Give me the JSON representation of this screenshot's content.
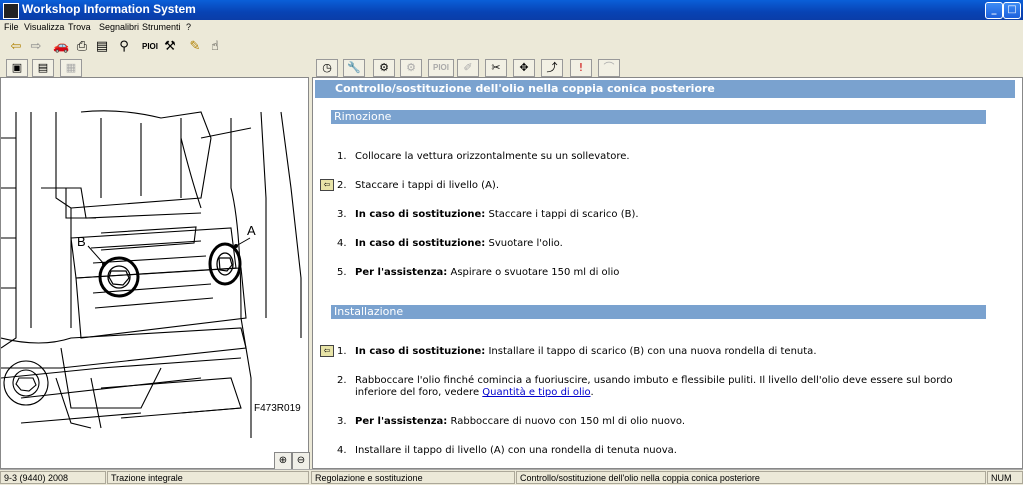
{
  "window": {
    "title": "Workshop Information System"
  },
  "menu": [
    "File",
    "Visualizza",
    "Trova",
    "Segnalibri",
    "Strumenti",
    "?"
  ],
  "toolbar": {
    "pioi_label": "PIOI"
  },
  "toolbar2": {
    "pioi_label": "PIOI"
  },
  "figure": {
    "callout_a": "A",
    "callout_b": "B",
    "ref": "F473R019"
  },
  "document": {
    "title": "Controllo/sostituzione dell'olio nella coppia conica posteriore",
    "removal": {
      "heading": "Rimozione",
      "steps": [
        {
          "num": "1.",
          "bold": "",
          "text": "Collocare la vettura orizzontalmente su un sollevatore."
        },
        {
          "num": "2.",
          "bold": "",
          "text": "Staccare i tappi di livello (A)."
        },
        {
          "num": "3.",
          "bold": "In caso di sostituzione:",
          "text": "Staccare i tappi di scarico (B)."
        },
        {
          "num": "4.",
          "bold": "In caso di sostituzione:",
          "text": "Svuotare l'olio."
        },
        {
          "num": "5.",
          "bold": "Per l'assistenza:",
          "text": "Aspirare o svuotare 150 ml di olio"
        }
      ]
    },
    "installation": {
      "heading": "Installazione",
      "steps": [
        {
          "num": "1.",
          "bold": "In caso di sostituzione:",
          "text": "Installare il tappo di scarico (B) con una nuova rondella di tenuta."
        },
        {
          "num": "2.",
          "bold": "",
          "text": "Rabboccare l'olio finché comincia a fuoriuscire, usando imbuto e flessibile puliti. Il livello dell'olio deve essere sul bordo",
          "text2": "inferiore del foro, vedere",
          "link": "Quantità e tipo di olio",
          "text3": "."
        },
        {
          "num": "3.",
          "bold": "Per l'assistenza:",
          "text": "Rabboccare di nuovo con 150 ml di olio nuovo."
        },
        {
          "num": "4.",
          "bold": "",
          "text": "Installare il tappo di livello (A) con una rondella di tenuta nuova."
        }
      ]
    }
  },
  "status": {
    "vehicle": "9-3 (9440) 2008",
    "drive": "Trazione integrale",
    "category": "Regolazione e sostituzione",
    "doc": "Controllo/sostituzione dell'olio nella coppia conica posteriore",
    "num": "NUM"
  }
}
